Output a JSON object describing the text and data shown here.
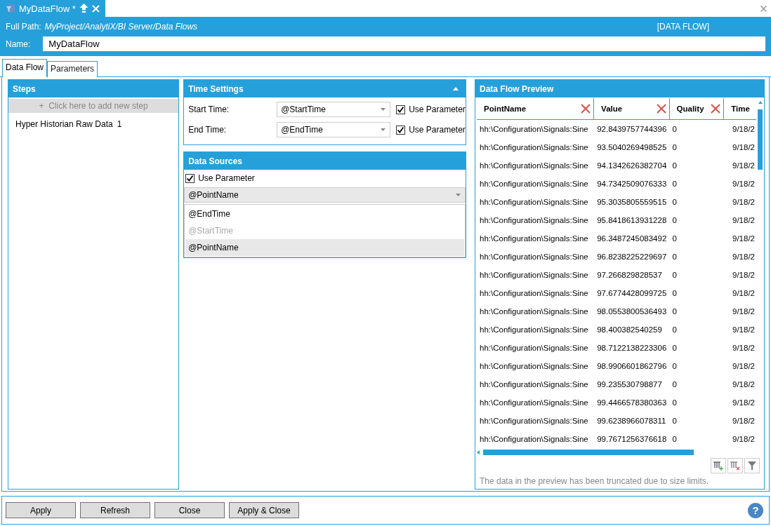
{
  "document_tab": {
    "title": "MyDataFlow *",
    "selected": true
  },
  "header": {
    "full_path_label": "Full Path:",
    "full_path": "MyProject/AnalytiX/BI Server/Data Flows",
    "type_badge": "[DATA FLOW]",
    "name_label": "Name:",
    "name_value": "MyDataFlow"
  },
  "tabs": [
    {
      "label": "Data Flow",
      "selected": true
    },
    {
      "label": "Parameters",
      "selected": false
    }
  ],
  "steps": {
    "title": "Steps",
    "add_step": "+  Click here to add new step",
    "items": [
      {
        "label": "Hyper Historian Raw Data",
        "count": "1"
      }
    ]
  },
  "time_settings": {
    "title": "Time Settings",
    "expanded": true,
    "rows": [
      {
        "label": "Start Time:",
        "value": "@StartTime",
        "use_parameter": {
          "label": "Use Parameter",
          "checked": true
        }
      },
      {
        "label": "End Time:",
        "value": "@EndTime",
        "use_parameter": {
          "label": "Use Parameter",
          "checked": true
        }
      }
    ]
  },
  "data_sources": {
    "title": "Data Sources",
    "use_parameter": {
      "label": "Use Parameter",
      "checked": true
    },
    "parameter": {
      "value": "@PointName",
      "expanded": true,
      "options": [
        {
          "label": "@EndTime",
          "disabled": false,
          "selected": false
        },
        {
          "label": "@StartTime",
          "disabled": true,
          "selected": false
        },
        {
          "label": "@PointName",
          "disabled": false,
          "selected": true
        }
      ]
    }
  },
  "preview": {
    "title": "Data Flow Preview",
    "columns": [
      {
        "label": "PointName",
        "filter_clear": true
      },
      {
        "label": "Value",
        "filter_clear": true
      },
      {
        "label": "Quality",
        "filter_clear": true
      },
      {
        "label": "Time",
        "filter_clear": false
      }
    ],
    "rows": [
      [
        "hh:\\Configuration\\Signals:Sine",
        "92.8439757744396",
        "0",
        "9/18/2"
      ],
      [
        "hh:\\Configuration\\Signals:Sine",
        "93.5040269498525",
        "0",
        "9/18/2"
      ],
      [
        "hh:\\Configuration\\Signals:Sine",
        "94.1342626382704",
        "0",
        "9/18/2"
      ],
      [
        "hh:\\Configuration\\Signals:Sine",
        "94.7342509076333",
        "0",
        "9/18/2"
      ],
      [
        "hh:\\Configuration\\Signals:Sine",
        "95.3035805559515",
        "0",
        "9/18/2"
      ],
      [
        "hh:\\Configuration\\Signals:Sine",
        "95.8418613931228",
        "0",
        "9/18/2"
      ],
      [
        "hh:\\Configuration\\Signals:Sine",
        "96.3487245083492",
        "0",
        "9/18/2"
      ],
      [
        "hh:\\Configuration\\Signals:Sine",
        "96.8238225229697",
        "0",
        "9/18/2"
      ],
      [
        "hh:\\Configuration\\Signals:Sine",
        "97.266829828537",
        "0",
        "9/18/2"
      ],
      [
        "hh:\\Configuration\\Signals:Sine",
        "97.6774428099725",
        "0",
        "9/18/2"
      ],
      [
        "hh:\\Configuration\\Signals:Sine",
        "98.0553800536493",
        "0",
        "9/18/2"
      ],
      [
        "hh:\\Configuration\\Signals:Sine",
        "98.400382540259",
        "0",
        "9/18/2"
      ],
      [
        "hh:\\Configuration\\Signals:Sine",
        "98.7122138223306",
        "0",
        "9/18/2"
      ],
      [
        "hh:\\Configuration\\Signals:Sine",
        "98.9906601862796",
        "0",
        "9/18/2"
      ],
      [
        "hh:\\Configuration\\Signals:Sine",
        "99.235530798877",
        "0",
        "9/18/2"
      ],
      [
        "hh:\\Configuration\\Signals:Sine",
        "99.4466578380363",
        "0",
        "9/18/2"
      ],
      [
        "hh:\\Configuration\\Signals:Sine",
        "99.6238966078311",
        "0",
        "9/18/2"
      ],
      [
        "hh:\\Configuration\\Signals:Sine",
        "99.7671256376618",
        "0",
        "9/18/2"
      ]
    ],
    "note": "The data in the preview has been truncated due to size limits."
  },
  "buttons": [
    "Apply",
    "Refresh",
    "Close",
    "Apply & Close"
  ],
  "help_button": "?"
}
